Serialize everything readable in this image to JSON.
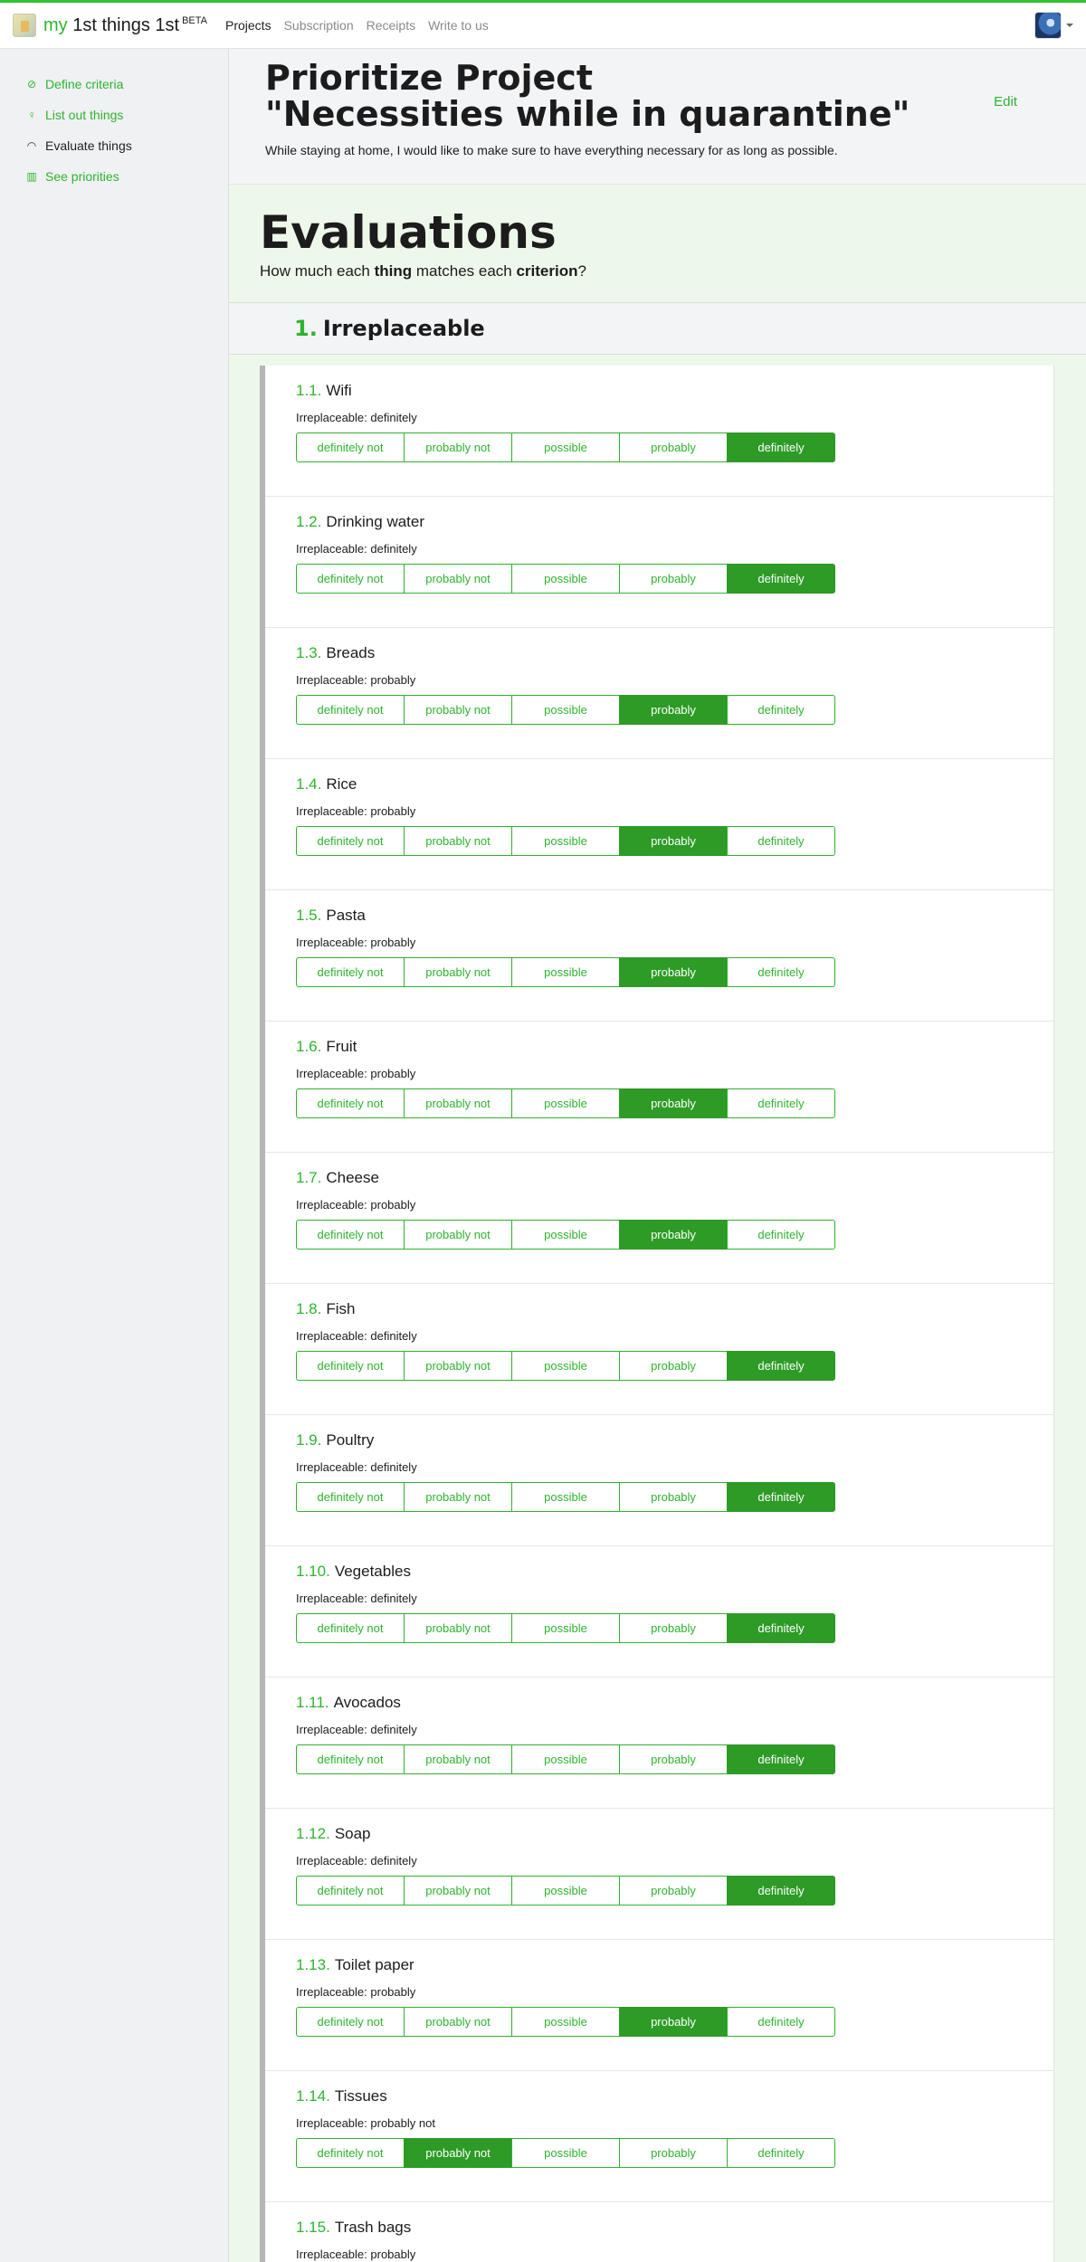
{
  "header": {
    "brand_my": "my",
    "brand_rest": "1st things 1st",
    "brand_beta": "BETA",
    "nav": [
      "Projects",
      "Subscription",
      "Receipts",
      "Write to us"
    ]
  },
  "sidebar": {
    "items": [
      {
        "label": "Define criteria",
        "icon": "compass-icon"
      },
      {
        "label": "List out things",
        "icon": "lightbulb-icon"
      },
      {
        "label": "Evaluate things",
        "icon": "gauge-icon"
      },
      {
        "label": "See priorities",
        "icon": "bar-chart-icon"
      }
    ]
  },
  "project": {
    "title_line1": "Prioritize Project",
    "title_line2": "\"Necessities while in quarantine\"",
    "description": "While staying at home, I would like to make sure to have everything necessary for as long as possible.",
    "edit_label": "Edit"
  },
  "evaluations": {
    "title": "Evaluations",
    "subtitle_pre": "How much each ",
    "subtitle_thing": "thing",
    "subtitle_mid": " matches each ",
    "subtitle_criterion": "criterion",
    "subtitle_post": "?",
    "criterion_number": "1.",
    "criterion_name": "Irreplaceable",
    "options": [
      "definitely not",
      "probably not",
      "possible",
      "probably",
      "definitely"
    ],
    "items": [
      {
        "index": "1.1.",
        "name": "Wifi",
        "status": "Irreplaceable: definitely",
        "selected": 4
      },
      {
        "index": "1.2.",
        "name": "Drinking water",
        "status": "Irreplaceable: definitely",
        "selected": 4
      },
      {
        "index": "1.3.",
        "name": "Breads",
        "status": "Irreplaceable: probably",
        "selected": 3
      },
      {
        "index": "1.4.",
        "name": "Rice",
        "status": "Irreplaceable: probably",
        "selected": 3
      },
      {
        "index": "1.5.",
        "name": "Pasta",
        "status": "Irreplaceable: probably",
        "selected": 3
      },
      {
        "index": "1.6.",
        "name": "Fruit",
        "status": "Irreplaceable: probably",
        "selected": 3
      },
      {
        "index": "1.7.",
        "name": "Cheese",
        "status": "Irreplaceable: probably",
        "selected": 3
      },
      {
        "index": "1.8.",
        "name": "Fish",
        "status": "Irreplaceable: definitely",
        "selected": 4
      },
      {
        "index": "1.9.",
        "name": "Poultry",
        "status": "Irreplaceable: definitely",
        "selected": 4
      },
      {
        "index": "1.10.",
        "name": "Vegetables",
        "status": "Irreplaceable: definitely",
        "selected": 4
      },
      {
        "index": "1.11.",
        "name": "Avocados",
        "status": "Irreplaceable: definitely",
        "selected": 4
      },
      {
        "index": "1.12.",
        "name": "Soap",
        "status": "Irreplaceable: definitely",
        "selected": 4
      },
      {
        "index": "1.13.",
        "name": "Toilet paper",
        "status": "Irreplaceable: probably",
        "selected": 3
      },
      {
        "index": "1.14.",
        "name": "Tissues",
        "status": "Irreplaceable: probably not",
        "selected": 1
      },
      {
        "index": "1.15.",
        "name": "Trash bags",
        "status": "Irreplaceable: probably",
        "selected": 3
      }
    ]
  }
}
